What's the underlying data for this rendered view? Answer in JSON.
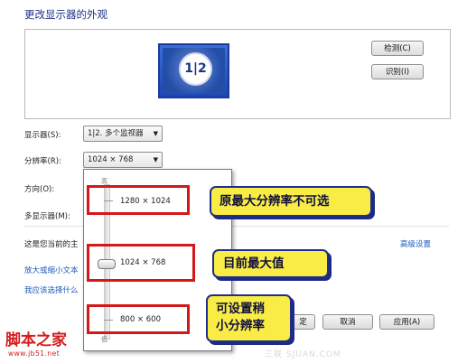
{
  "window": {
    "title": "更改显示器的外观"
  },
  "preview": {
    "monitor_label": "1|2",
    "detect_label": "检测(C)",
    "identify_label": "识别(I)"
  },
  "form": {
    "display_label": "显示器(S):",
    "display_value": "1|2. 多个监视器",
    "resolution_label": "分辨率(R):",
    "resolution_value": "1024 × 768",
    "orientation_label": "方向(O):",
    "multi_display_label": "多显示器(M):",
    "main_display_text": "这是您当前的主"
  },
  "resolution_dropdown": {
    "high_label": "高",
    "low_label": "低",
    "options": [
      "1280 × 1024",
      "1024 × 768",
      "800 × 600"
    ],
    "selected": "1024 × 768"
  },
  "links": {
    "advanced_settings": "高级设置",
    "text_size": "放大或缩小文本",
    "which_settings": "我应该选择什么"
  },
  "buttons": {
    "ok": "定",
    "cancel": "取消",
    "apply": "应用(A)"
  },
  "callouts": {
    "max_res_not_selectable": "原最大分辨率不可选",
    "current_max": "目前最大值",
    "can_set_line1": "可设置稍",
    "can_set_line2": "小分辨率"
  },
  "watermark": {
    "logo": "脚本之家",
    "url": "www.jb51.net",
    "faint": "三联 SJUAN.COM"
  },
  "colors": {
    "annotation_red": "#d21818",
    "callout_yellow": "#f8ec45",
    "link_blue": "#1a5bb8",
    "title_blue": "#1e3287"
  }
}
